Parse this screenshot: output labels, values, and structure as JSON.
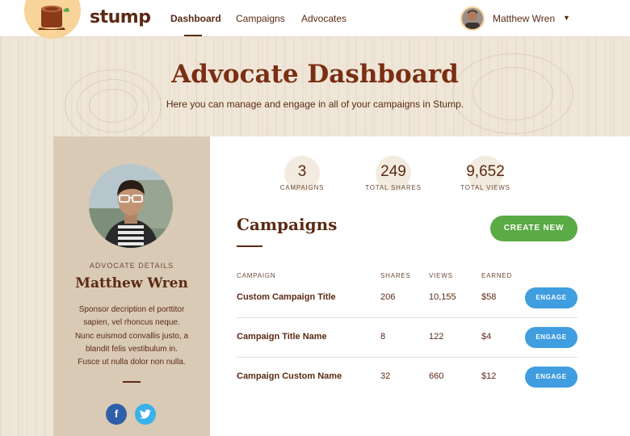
{
  "brand": {
    "name": "stump"
  },
  "nav": {
    "items": [
      {
        "label": "Dashboard",
        "active": true
      },
      {
        "label": "Campaigns",
        "active": false
      },
      {
        "label": "Advocates",
        "active": false
      }
    ],
    "user_name": "Matthew Wren"
  },
  "hero": {
    "title": "Advocate Dashboard",
    "subtitle": "Here you can manage and engage in all of your campaigns in Stump."
  },
  "advocate": {
    "section_label": "ADVOCATE DETAILS",
    "name": "Matthew Wren",
    "bio": "Sponsor decription el porttitor sapien, vel rhoncus neque. Nunc euismod convallis justo, a blandit felis vestibulum in. Fusce ut nulla dolor non nulla.",
    "social": {
      "facebook": "f",
      "twitter": "twitter-icon"
    }
  },
  "stats": [
    {
      "value": "3",
      "label": "CAMPAIGNS"
    },
    {
      "value": "249",
      "label": "TOTAL SHARES"
    },
    {
      "value": "9,652",
      "label": "TOTAL VIEWS"
    }
  ],
  "campaigns": {
    "title": "Campaigns",
    "create_label": "CREATE NEW",
    "columns": [
      "CAMPAIGN",
      "SHARES",
      "VIEWS",
      "EARNED"
    ],
    "engage_label": "ENGAGE",
    "rows": [
      {
        "name": "Custom Campaign Title",
        "shares": "206",
        "views": "10,155",
        "earned": "$58"
      },
      {
        "name": "Campaign Title Name",
        "shares": "8",
        "views": "122",
        "earned": "$4"
      },
      {
        "name": "Campaign Custom Name",
        "shares": "32",
        "views": "660",
        "earned": "$12"
      }
    ]
  },
  "colors": {
    "brand_brown": "#5b2a14",
    "create_green": "#5aaa45",
    "engage_blue": "#3f9de0",
    "facebook": "#2f5fa8",
    "twitter": "#3ab1ea"
  }
}
